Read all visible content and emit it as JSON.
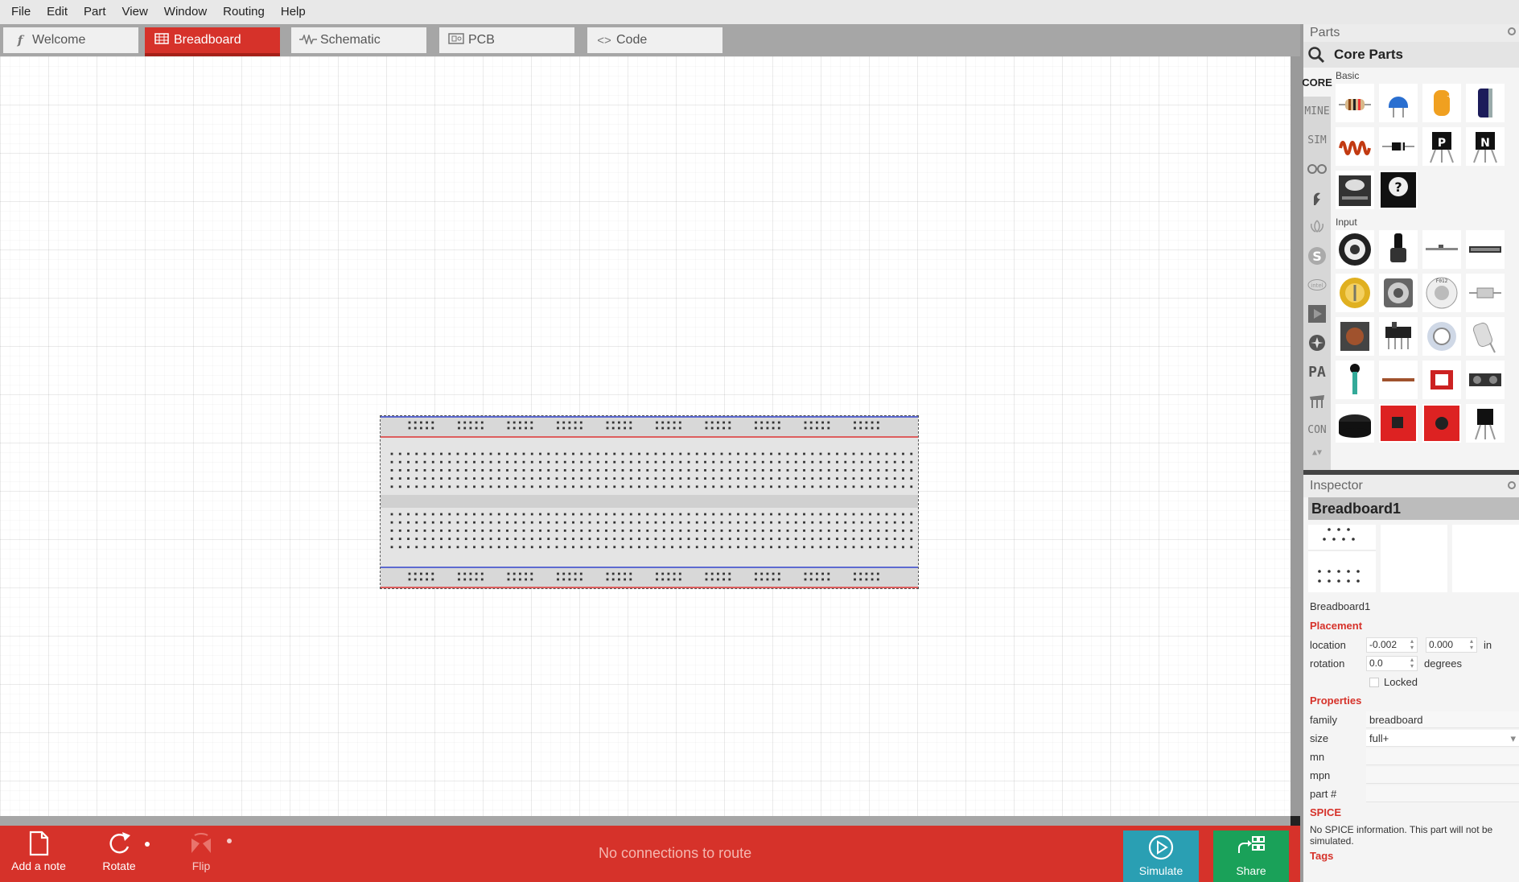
{
  "menu": [
    "File",
    "Edit",
    "Part",
    "View",
    "Window",
    "Routing",
    "Help"
  ],
  "tabs": [
    {
      "label": "Welcome",
      "icon": "fritzing-f-icon"
    },
    {
      "label": "Breadboard",
      "icon": "breadboard-icon"
    },
    {
      "label": "Schematic",
      "icon": "resistor-zigzag-icon"
    },
    {
      "label": "PCB",
      "icon": "pcb-icon"
    },
    {
      "label": "Code",
      "icon": "code-brackets-icon"
    }
  ],
  "active_tab": "Breadboard",
  "canvas": {
    "logo": "fritzing"
  },
  "toolbar": {
    "add_note": "Add a note",
    "rotate": "Rotate",
    "flip": "Flip",
    "status": "No connections to route",
    "simulate": "Simulate",
    "share": "Share"
  },
  "parts": {
    "title": "Parts",
    "bin_title": "Core Parts",
    "bins": [
      "CORE",
      "MINE",
      "SIM",
      "arduino",
      "sparkfun",
      "seeed",
      "snootlab",
      "intel",
      "playground",
      "adafruit",
      "PA",
      "contrib",
      "CON"
    ],
    "active_bin": "CORE",
    "sections": [
      {
        "label": "Basic",
        "items": [
          "resistor",
          "ceramic-capacitor",
          "tantalum-capacitor",
          "electrolytic-capacitor",
          "inductor",
          "diode",
          "pnp-transistor",
          "npn-transistor",
          "fet-transistor",
          "mystery-part"
        ]
      },
      {
        "label": "Input",
        "items": [
          "rotary-potentiometer",
          "slide-potentiometer",
          "trimmer-strip",
          "lcd-strip",
          "trim-potentiometer",
          "rotary-encoder",
          "dip-rotary-switch",
          "slide-switch",
          "pushbutton",
          "toggle-switch",
          "reed-sensor",
          "tilt-sensor",
          "thumb-joystick",
          "flex-sensor",
          "hall-sensor",
          "ultrasonic-sensor",
          "piezo",
          "red-breakout-board",
          "red-breakout-board-2",
          "temperature-sensor"
        ]
      }
    ]
  },
  "inspector": {
    "title": "Inspector",
    "part_name": "Breadboard1",
    "part_label": "Breadboard1",
    "placement_header": "Placement",
    "location_label": "location",
    "location_x": "-0.002",
    "location_y": "0.000",
    "location_unit": "in",
    "rotation_label": "rotation",
    "rotation_value": "0.0",
    "rotation_unit": "degrees",
    "locked_label": "Locked",
    "properties_header": "Properties",
    "properties": [
      {
        "key": "family",
        "value": "breadboard"
      },
      {
        "key": "size",
        "value": "full+"
      },
      {
        "key": "mn",
        "value": ""
      },
      {
        "key": "mpn",
        "value": ""
      },
      {
        "key": "part #",
        "value": ""
      }
    ],
    "spice_header": "SPICE",
    "spice_note": "No SPICE information. This part will not be simulated.",
    "tags_header": "Tags"
  },
  "colors": {
    "accent": "#d6322a",
    "simulate": "#2a9fb3",
    "share": "#1aa159"
  }
}
